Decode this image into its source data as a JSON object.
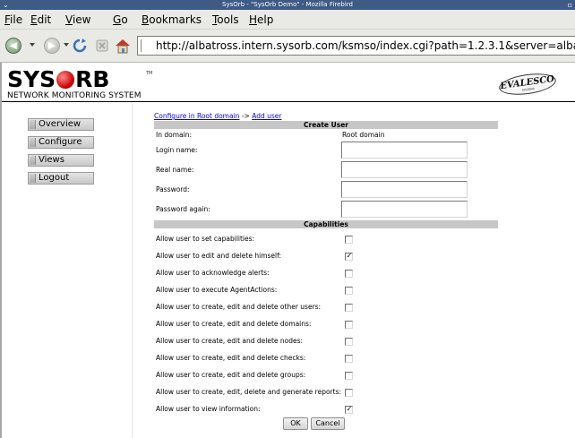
{
  "window": {
    "title": "SysOrb - \"SysOrb Demo\" - Mozilla Firebird",
    "menu_glyph": "⌄",
    "close_glyph": "▫"
  },
  "menu": {
    "items": [
      {
        "mnemonic": "F",
        "rest": "ile"
      },
      {
        "mnemonic": "E",
        "rest": "dit"
      },
      {
        "mnemonic": "V",
        "rest": "iew"
      },
      {
        "mnemonic": "G",
        "rest": "o"
      },
      {
        "mnemonic": "B",
        "rest": "ookmarks"
      },
      {
        "mnemonic": "T",
        "rest": "ools"
      },
      {
        "mnemonic": "H",
        "rest": "elp"
      }
    ]
  },
  "nav": {
    "back_glyph": "◀",
    "forward_glyph": "▶",
    "url": "http://albatross.intern.sysorb.com/ksmso/index.cgi?path=1.2.3.1&server=alba",
    "icons": [
      "back-icon",
      "forward-icon",
      "reload-icon",
      "stop-icon",
      "home-icon"
    ]
  },
  "header": {
    "logo_text_pre": "SYS",
    "logo_text_post": "RB",
    "logo_tm": "TM",
    "subtitle": "NETWORK MONITORING SYSTEM",
    "partner_logo": "EVALESCO",
    "partner_sub": "SYSTEMS"
  },
  "sidebar": {
    "items": [
      {
        "label": "Overview"
      },
      {
        "label": "Configure"
      },
      {
        "label": "Views"
      },
      {
        "label": "Logout"
      }
    ]
  },
  "breadcrumb": {
    "link1": "Configure in Root domain",
    "separator": "->",
    "link2": "Add user"
  },
  "create_user": {
    "heading": "Create User",
    "domain_label": "In domain:",
    "domain_value": "Root domain",
    "fields": [
      {
        "label": "Login name:",
        "value": ""
      },
      {
        "label": "Real name:",
        "value": ""
      },
      {
        "label": "Password:",
        "value": ""
      },
      {
        "label": "Password again:",
        "value": ""
      }
    ]
  },
  "capabilities": {
    "heading": "Capabilities",
    "items": [
      {
        "label": "Allow user to set capabilities:",
        "checked": false
      },
      {
        "label": "Allow user to edit and delete himself:",
        "checked": true
      },
      {
        "label": "Allow user to acknowledge alerts:",
        "checked": false
      },
      {
        "label": "Allow user to execute AgentActions:",
        "checked": false
      },
      {
        "label": "Allow user to create, edit and delete other users:",
        "checked": false
      },
      {
        "label": "Allow user to create, edit and delete domains:",
        "checked": false
      },
      {
        "label": "Allow user to create, edit and delete nodes:",
        "checked": false
      },
      {
        "label": "Allow user to create, edit and delete checks:",
        "checked": false
      },
      {
        "label": "Allow user to create, edit and delete groups:",
        "checked": false
      },
      {
        "label": "Allow user to create, edit, delete and generate reports:",
        "checked": false
      },
      {
        "label": "Allow user to view information:",
        "checked": true
      }
    ],
    "check_glyph": "✓"
  },
  "buttons": {
    "ok": "OK",
    "cancel": "Cancel"
  }
}
